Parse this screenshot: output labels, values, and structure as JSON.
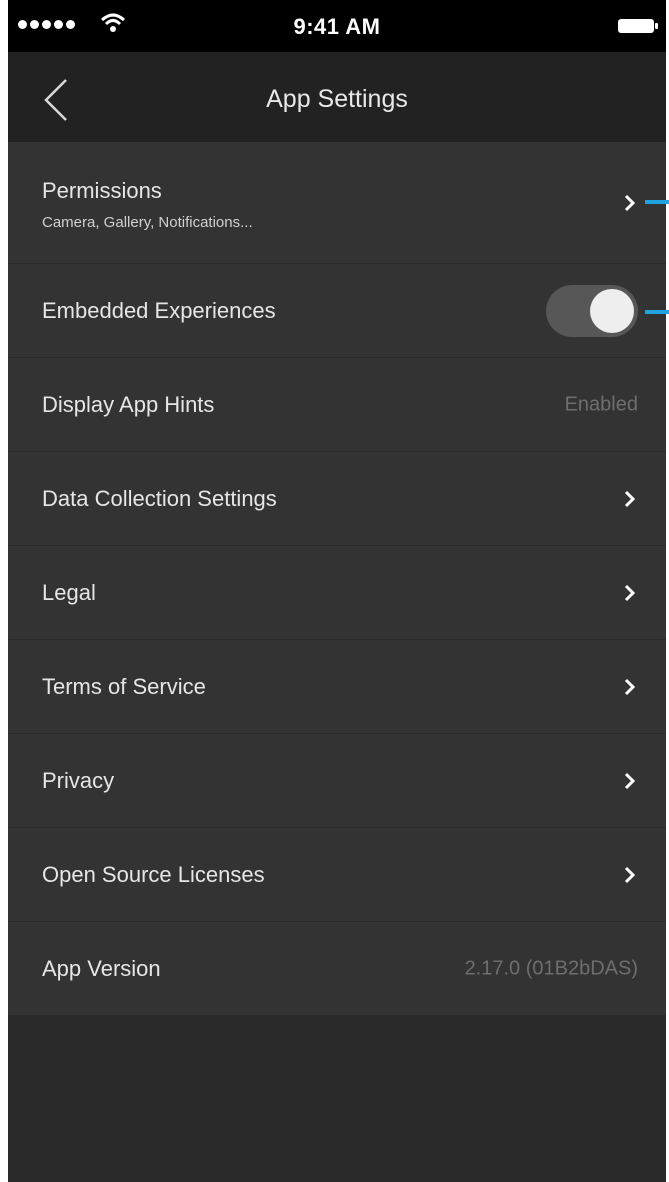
{
  "status_bar": {
    "time": "9:41 AM",
    "signal_icon": "signal-dots-icon",
    "wifi_icon": "wifi-icon",
    "battery_icon": "battery-icon"
  },
  "nav": {
    "title": "App Settings",
    "back_icon": "back-chevron-icon"
  },
  "settings": {
    "permissions": {
      "label": "Permissions",
      "sublabel": "Camera, Gallery, Notifications..."
    },
    "embedded": {
      "label": "Embedded Experiences",
      "enabled": true
    },
    "hints": {
      "label": "Display App Hints",
      "value": "Enabled"
    },
    "data_collection": {
      "label": "Data Collection Settings"
    },
    "legal": {
      "label": "Legal"
    },
    "terms": {
      "label": "Terms of Service"
    },
    "privacy": {
      "label": "Privacy"
    },
    "licenses": {
      "label": "Open Source Licenses"
    },
    "version": {
      "label": "App Version",
      "value": "2.17.0 (01B2bDAS)"
    }
  },
  "colors": {
    "background": "#2a2a2a",
    "row": "#333333",
    "navbar": "#222222",
    "callout": "#1fa4e0"
  }
}
